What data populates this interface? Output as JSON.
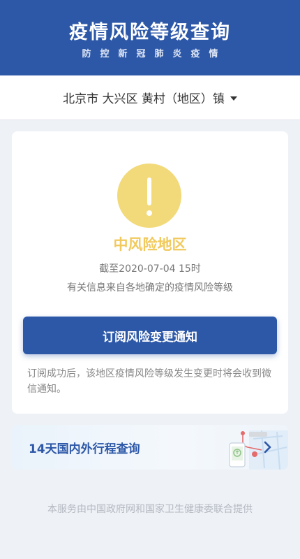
{
  "header": {
    "title": "疫情风险等级查询",
    "subtitle": "防控新冠肺炎疫情"
  },
  "location": {
    "selected": "北京市 大兴区 黄村（地区）镇",
    "dropdown_icon": "caret-down-icon"
  },
  "status_card": {
    "icon": "exclamation-icon",
    "icon_color": "#f2da7a",
    "risk_level": "中风险地区",
    "risk_color": "#f1c95c",
    "as_of": "截至2020-07-04 15时",
    "source_note": "有关信息来自各地确定的疫情风险等级",
    "subscribe_button": "订阅风险变更通知",
    "subscribe_tip": "订阅成功后，该地区疫情风险等级发生变更时将会收到微信通知。"
  },
  "trip_card": {
    "label": "14天国内外行程查询",
    "illustration": "map-route-phone-icon",
    "arrow_icon": "chevron-right-icon"
  },
  "footer": {
    "note": "本服务由中国政府网和国家卫生健康委联合提供"
  },
  "colors": {
    "brand": "#2d58a8",
    "background": "#eef1f6"
  }
}
